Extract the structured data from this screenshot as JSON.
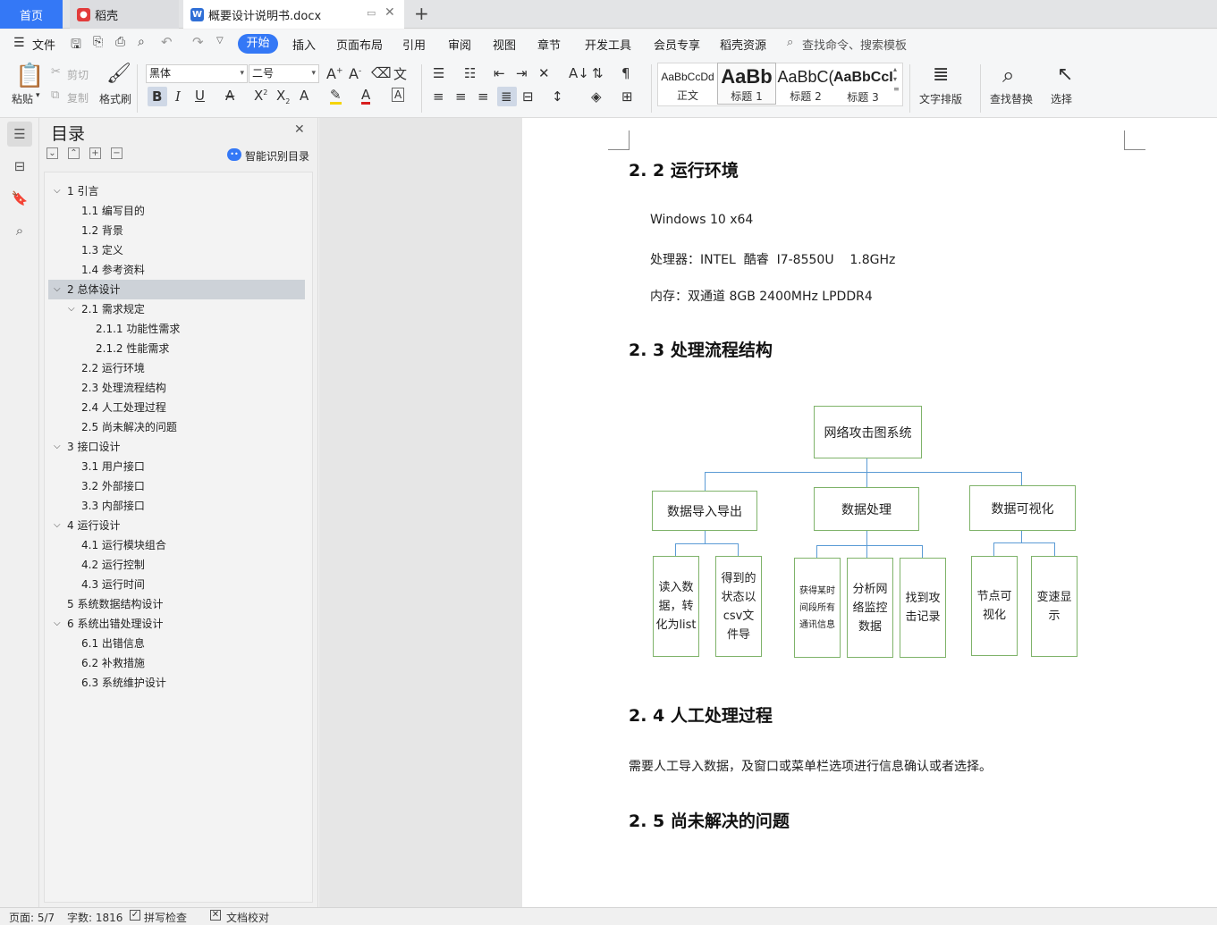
{
  "tabs": {
    "home": "首页",
    "wps": "稻壳",
    "doc": "概要设计说明书.docx",
    "new_tab": "+"
  },
  "menu": {
    "file": "文件",
    "items": [
      "开始",
      "插入",
      "页面布局",
      "引用",
      "审阅",
      "视图",
      "章节",
      "开发工具",
      "会员专享",
      "稻壳资源"
    ],
    "search": "查找命令、搜索模板"
  },
  "ribbon": {
    "paste": "粘贴",
    "cut": "剪切",
    "copy": "复制",
    "format_painter": "格式刷",
    "font_name": "黑体",
    "font_size": "二号",
    "styles": [
      {
        "sample": "AaBbCcDd",
        "name": "正文"
      },
      {
        "sample": "AaBb",
        "name": "标题 1"
      },
      {
        "sample": "AaBbC(",
        "name": "标题 2"
      },
      {
        "sample": "AaBbCcI",
        "name": "标题 3"
      }
    ],
    "text_layout": "文字排版",
    "find_replace": "查找替换",
    "select": "选择"
  },
  "nav": {
    "title": "目录",
    "smart_toc": "智能识别目录",
    "toc": [
      {
        "label": "1  引言",
        "level": 1,
        "chev": "v"
      },
      {
        "label": "1.1 编写目的",
        "level": 2,
        "chev": ""
      },
      {
        "label": "1.2 背景",
        "level": 2,
        "chev": ""
      },
      {
        "label": "1.3 定义",
        "level": 2,
        "chev": ""
      },
      {
        "label": "1.4 参考资料",
        "level": 2,
        "chev": ""
      },
      {
        "label": "2 总体设计",
        "level": 1,
        "chev": "v",
        "selected": true
      },
      {
        "label": "2.1  需求规定",
        "level": 2,
        "chev": "v"
      },
      {
        "label": "2.1.1 功能性需求",
        "level": 3,
        "chev": ""
      },
      {
        "label": "2.1.2 性能需求",
        "level": 3,
        "chev": ""
      },
      {
        "label": "2.2 运行环境",
        "level": 2,
        "chev": ""
      },
      {
        "label": "2.3 处理流程结构",
        "level": 2,
        "chev": ""
      },
      {
        "label": "2.4 人工处理过程",
        "level": 2,
        "chev": ""
      },
      {
        "label": "2.5 尚未解决的问题",
        "level": 2,
        "chev": ""
      },
      {
        "label": "3  接口设计",
        "level": 1,
        "chev": "v"
      },
      {
        "label": "3.1 用户接口",
        "level": 2,
        "chev": ""
      },
      {
        "label": "3.2 外部接口",
        "level": 2,
        "chev": ""
      },
      {
        "label": "3.3 内部接口",
        "level": 2,
        "chev": ""
      },
      {
        "label": "4  运行设计",
        "level": 1,
        "chev": "v"
      },
      {
        "label": "4.1  运行模块组合",
        "level": 2,
        "chev": ""
      },
      {
        "label": "4.2  运行控制",
        "level": 2,
        "chev": ""
      },
      {
        "label": "4.3  运行时间",
        "level": 2,
        "chev": ""
      },
      {
        "label": "5  系统数据结构设计",
        "level": 1,
        "chev": ""
      },
      {
        "label": "6  系统出错处理设计",
        "level": 1,
        "chev": "v"
      },
      {
        "label": "6.1  出错信息",
        "level": 2,
        "chev": ""
      },
      {
        "label": "6.2  补救措施",
        "level": 2,
        "chev": ""
      },
      {
        "label": "6.3 系统维护设计",
        "level": 2,
        "chev": ""
      }
    ]
  },
  "doc": {
    "h_22": "2. 2 运行环境",
    "env_os": "Windows 10 x64",
    "env_cpu": "处理器：INTEL  酷睿  I7-8550U    1.8GHz",
    "env_mem": "内存：双通道 8GB 2400MHz LPDDR4",
    "h_23": "2. 3 处理流程结构",
    "h_24": "2. 4 人工处理过程",
    "p_24": "需要人工导入数据，及窗口或菜单栏选项进行信息确认或者选择。",
    "h_25": "2. 5 尚未解决的问题"
  },
  "diagram": {
    "root": "网络攻击图系统",
    "level1": [
      "数据导入导出",
      "数据处理",
      "数据可视化"
    ],
    "leaves": [
      "读入数据，转化为list",
      "得到的状态以csv文件导",
      "获得某时间段所有通讯信息",
      "分析网络监控数据",
      "找到攻击记录",
      "节点可视化",
      "变速显示"
    ]
  },
  "status": {
    "page": "页面: 5/7",
    "words": "字数: 1816",
    "spell": "拼写检查",
    "proof": "文档校对"
  }
}
